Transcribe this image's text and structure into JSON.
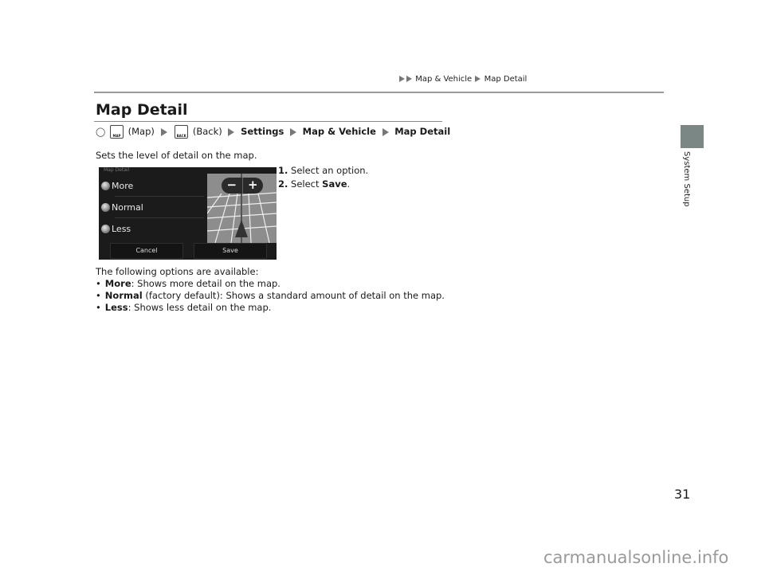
{
  "breadcrumb": {
    "items": [
      "Map & Vehicle",
      "Map Detail"
    ]
  },
  "page": {
    "title": "Map Detail",
    "number": "31",
    "section_tab": "System Setup",
    "section_tab_color": "#7b8785"
  },
  "path": {
    "home_icon": "home-icon",
    "map_key_label": "MAP",
    "map_text": "(Map)",
    "back_key_label": "BACK",
    "back_text": "(Back)",
    "steps": [
      "Settings",
      "Map & Vehicle",
      "Map Detail"
    ]
  },
  "intro": "Sets the level of detail on the map.",
  "instructions": [
    {
      "num": "1.",
      "text": "Select an option."
    },
    {
      "num": "2.",
      "pre": "Select ",
      "bold": "Save",
      "post": "."
    }
  ],
  "screen": {
    "title": "Map Detail",
    "options": [
      "More",
      "Normal",
      "Less"
    ],
    "zoom_out": "−",
    "zoom_in": "+",
    "cancel": "Cancel",
    "save": "Save"
  },
  "options_intro": "The following options are available:",
  "options": [
    {
      "name": "More",
      "desc": ": Shows more detail on the map."
    },
    {
      "name": "Normal",
      "desc": " (factory default): Shows a standard amount of detail on the map."
    },
    {
      "name": "Less",
      "desc": ": Shows less detail on the map."
    }
  ],
  "watermark": "carmanualsonline.info"
}
